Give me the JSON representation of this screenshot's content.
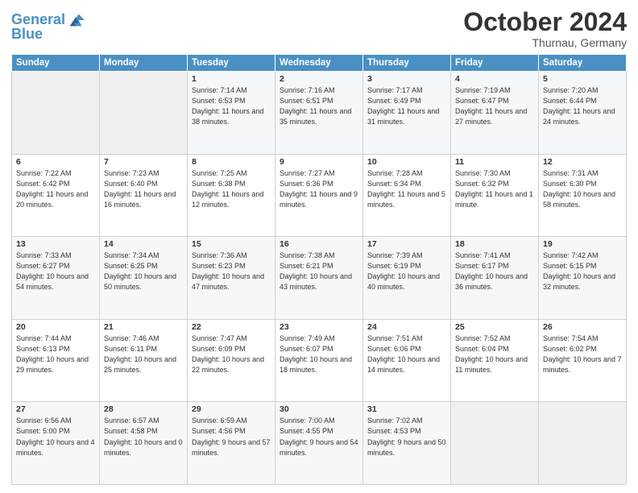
{
  "logo": {
    "line1": "General",
    "line2": "Blue"
  },
  "header": {
    "month": "October 2024",
    "location": "Thurnau, Germany"
  },
  "weekdays": [
    "Sunday",
    "Monday",
    "Tuesday",
    "Wednesday",
    "Thursday",
    "Friday",
    "Saturday"
  ],
  "weeks": [
    [
      {
        "day": "",
        "info": ""
      },
      {
        "day": "",
        "info": ""
      },
      {
        "day": "1",
        "info": "Sunrise: 7:14 AM\nSunset: 6:53 PM\nDaylight: 11 hours and 38 minutes."
      },
      {
        "day": "2",
        "info": "Sunrise: 7:16 AM\nSunset: 6:51 PM\nDaylight: 11 hours and 35 minutes."
      },
      {
        "day": "3",
        "info": "Sunrise: 7:17 AM\nSunset: 6:49 PM\nDaylight: 11 hours and 31 minutes."
      },
      {
        "day": "4",
        "info": "Sunrise: 7:19 AM\nSunset: 6:47 PM\nDaylight: 11 hours and 27 minutes."
      },
      {
        "day": "5",
        "info": "Sunrise: 7:20 AM\nSunset: 6:44 PM\nDaylight: 11 hours and 24 minutes."
      }
    ],
    [
      {
        "day": "6",
        "info": "Sunrise: 7:22 AM\nSunset: 6:42 PM\nDaylight: 11 hours and 20 minutes."
      },
      {
        "day": "7",
        "info": "Sunrise: 7:23 AM\nSunset: 6:40 PM\nDaylight: 11 hours and 16 minutes."
      },
      {
        "day": "8",
        "info": "Sunrise: 7:25 AM\nSunset: 6:38 PM\nDaylight: 11 hours and 12 minutes."
      },
      {
        "day": "9",
        "info": "Sunrise: 7:27 AM\nSunset: 6:36 PM\nDaylight: 11 hours and 9 minutes."
      },
      {
        "day": "10",
        "info": "Sunrise: 7:28 AM\nSunset: 6:34 PM\nDaylight: 11 hours and 5 minutes."
      },
      {
        "day": "11",
        "info": "Sunrise: 7:30 AM\nSunset: 6:32 PM\nDaylight: 11 hours and 1 minute."
      },
      {
        "day": "12",
        "info": "Sunrise: 7:31 AM\nSunset: 6:30 PM\nDaylight: 10 hours and 58 minutes."
      }
    ],
    [
      {
        "day": "13",
        "info": "Sunrise: 7:33 AM\nSunset: 6:27 PM\nDaylight: 10 hours and 54 minutes."
      },
      {
        "day": "14",
        "info": "Sunrise: 7:34 AM\nSunset: 6:25 PM\nDaylight: 10 hours and 50 minutes."
      },
      {
        "day": "15",
        "info": "Sunrise: 7:36 AM\nSunset: 6:23 PM\nDaylight: 10 hours and 47 minutes."
      },
      {
        "day": "16",
        "info": "Sunrise: 7:38 AM\nSunset: 6:21 PM\nDaylight: 10 hours and 43 minutes."
      },
      {
        "day": "17",
        "info": "Sunrise: 7:39 AM\nSunset: 6:19 PM\nDaylight: 10 hours and 40 minutes."
      },
      {
        "day": "18",
        "info": "Sunrise: 7:41 AM\nSunset: 6:17 PM\nDaylight: 10 hours and 36 minutes."
      },
      {
        "day": "19",
        "info": "Sunrise: 7:42 AM\nSunset: 6:15 PM\nDaylight: 10 hours and 32 minutes."
      }
    ],
    [
      {
        "day": "20",
        "info": "Sunrise: 7:44 AM\nSunset: 6:13 PM\nDaylight: 10 hours and 29 minutes."
      },
      {
        "day": "21",
        "info": "Sunrise: 7:46 AM\nSunset: 6:11 PM\nDaylight: 10 hours and 25 minutes."
      },
      {
        "day": "22",
        "info": "Sunrise: 7:47 AM\nSunset: 6:09 PM\nDaylight: 10 hours and 22 minutes."
      },
      {
        "day": "23",
        "info": "Sunrise: 7:49 AM\nSunset: 6:07 PM\nDaylight: 10 hours and 18 minutes."
      },
      {
        "day": "24",
        "info": "Sunrise: 7:51 AM\nSunset: 6:06 PM\nDaylight: 10 hours and 14 minutes."
      },
      {
        "day": "25",
        "info": "Sunrise: 7:52 AM\nSunset: 6:04 PM\nDaylight: 10 hours and 11 minutes."
      },
      {
        "day": "26",
        "info": "Sunrise: 7:54 AM\nSunset: 6:02 PM\nDaylight: 10 hours and 7 minutes."
      }
    ],
    [
      {
        "day": "27",
        "info": "Sunrise: 6:56 AM\nSunset: 5:00 PM\nDaylight: 10 hours and 4 minutes."
      },
      {
        "day": "28",
        "info": "Sunrise: 6:57 AM\nSunset: 4:58 PM\nDaylight: 10 hours and 0 minutes."
      },
      {
        "day": "29",
        "info": "Sunrise: 6:59 AM\nSunset: 4:56 PM\nDaylight: 9 hours and 57 minutes."
      },
      {
        "day": "30",
        "info": "Sunrise: 7:00 AM\nSunset: 4:55 PM\nDaylight: 9 hours and 54 minutes."
      },
      {
        "day": "31",
        "info": "Sunrise: 7:02 AM\nSunset: 4:53 PM\nDaylight: 9 hours and 50 minutes."
      },
      {
        "day": "",
        "info": ""
      },
      {
        "day": "",
        "info": ""
      }
    ]
  ]
}
